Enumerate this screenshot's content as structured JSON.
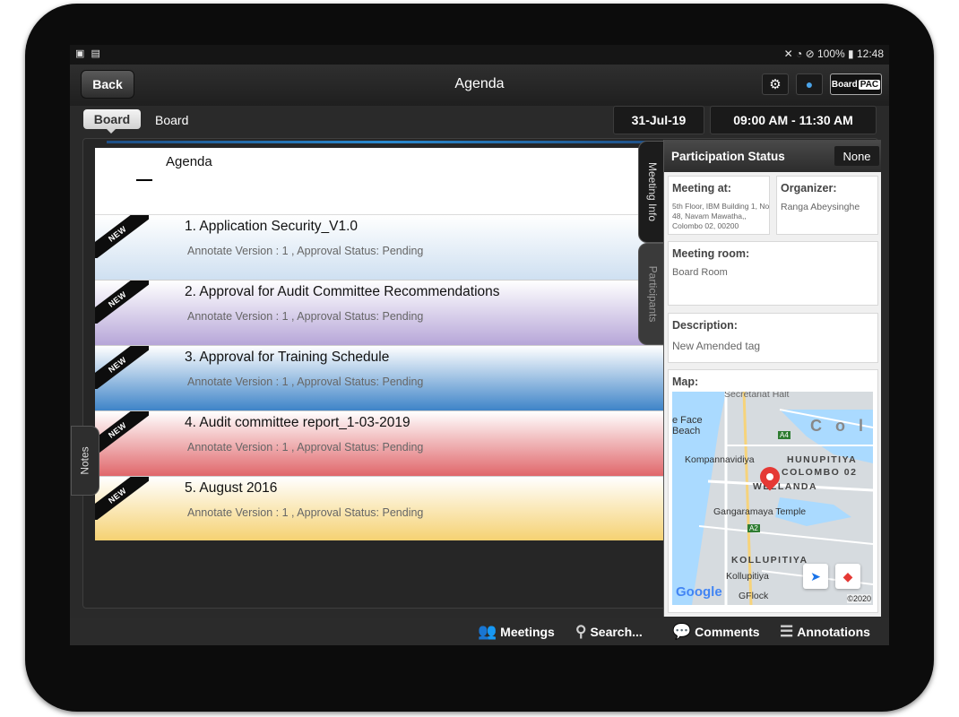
{
  "status_bar": {
    "left_icons": [
      "screenshot-icon",
      "sd-card-icon"
    ],
    "right_icons": [
      "mute-icon",
      "wifi-icon",
      "no-disturb-icon",
      "battery-icon"
    ],
    "battery": "100%",
    "time": "12:48"
  },
  "header": {
    "back_label": "Back",
    "title": "Agenda",
    "logo_board": "Board",
    "logo_pac": "PAC"
  },
  "breadcrumb": {
    "chip": "Board",
    "text": "Board"
  },
  "meeting": {
    "date": "31-Jul-19",
    "time": "09:00 AM - 11:30 AM"
  },
  "agenda": {
    "heading": "Agenda",
    "badge": "NEW",
    "items": [
      {
        "title": "1. Application Security_V1.0",
        "meta": "Annotate Version : 1 ,  Approval Status: Pending",
        "color": "#cfe0f1"
      },
      {
        "title": "2. Approval for Audit Committee Recommendations",
        "meta": "Annotate Version : 1 ,  Approval Status: Pending",
        "color": "#b7a6d8"
      },
      {
        "title": "3. Approval for Training Schedule",
        "meta": "Annotate Version : 1 ,  Approval Status: Pending",
        "color": "#3e84c8"
      },
      {
        "title": "4. Audit committee report_1-03-2019",
        "meta": "Annotate Version : 1 ,  Approval Status: Pending",
        "color": "#e0676b"
      },
      {
        "title": "5. August 2016",
        "meta": "Annotate Version : 1 ,  Approval Status: Pending",
        "color": "#f5d170"
      }
    ]
  },
  "side_tabs": {
    "meeting_info": "Meeting Info",
    "participants": "Participants",
    "notes": "Notes"
  },
  "info": {
    "participation_label": "Participation Status",
    "participation_value": "None",
    "meeting_at_label": "Meeting at:",
    "meeting_at_value": "5th Floor, IBM Building 1, No 48, Navam Mawatha,, Colombo 02, 00200",
    "organizer_label": "Organizer:",
    "organizer_value": "Ranga Abeysinghe",
    "room_label": "Meeting room:",
    "room_value": "Board Room",
    "description_label": "Description:",
    "description_value": "New Amended tag",
    "map_label": "Map:"
  },
  "map": {
    "labels": [
      "Secretariat Halt",
      "e Face",
      "Beach",
      "C o l o",
      "Kompannavidiya",
      "HUNUPITIYA",
      "COLOMBO 02",
      "WELLANDA",
      "Gangaramaya Temple",
      "KOLLUPITIYA",
      "Kollupitiya",
      "GFlock",
      "A4",
      "A2"
    ],
    "google": "Google",
    "copyright": "©2020"
  },
  "bottom_nav": {
    "meetings": "Meetings",
    "search": "Search...",
    "comments": "Comments",
    "annotations": "Annotations"
  },
  "colors": {
    "accent_blue": "#2a8ad0",
    "frame": "#0c0c0c",
    "screen": "#2a2a2a"
  }
}
